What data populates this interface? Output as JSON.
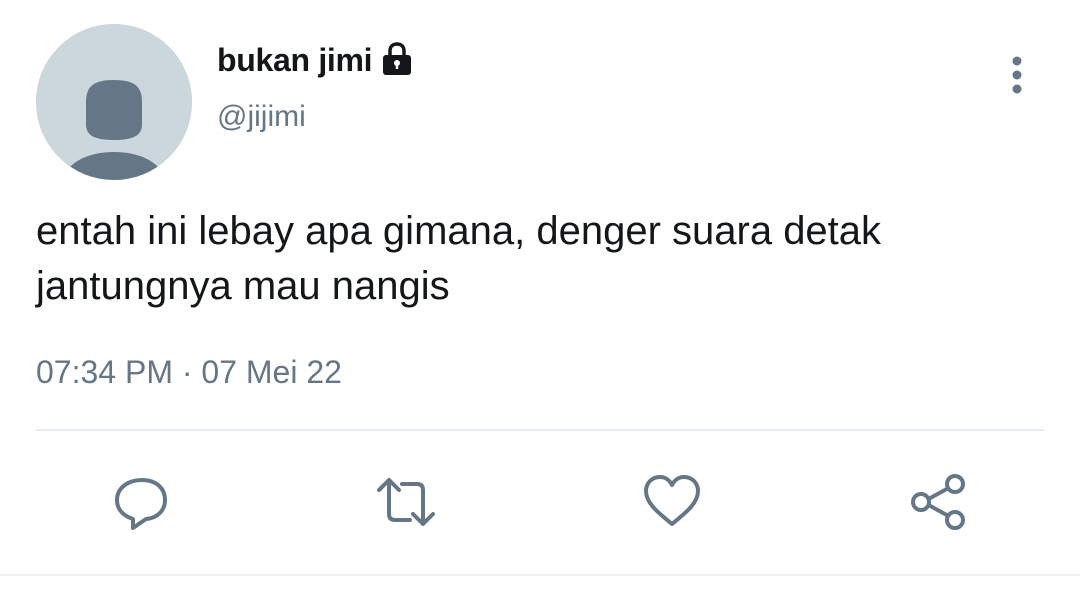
{
  "user": {
    "display_name": "bukan jimi",
    "handle": "@jijimi",
    "protected_icon": "lock-icon",
    "avatar": "default-avatar"
  },
  "tweet": {
    "text_line1": "entah ini lebay apa gimana, denger suara detak",
    "text_line2": "jantungnya mau nangis",
    "timestamp": "07:34 PM · 07 Mei 22"
  },
  "actions": [
    {
      "name": "reply",
      "icon": "reply-icon"
    },
    {
      "name": "retweet",
      "icon": "retweet-icon"
    },
    {
      "name": "like",
      "icon": "heart-icon"
    },
    {
      "name": "share",
      "icon": "share-icon"
    }
  ],
  "colors": {
    "text_primary": "#14171a",
    "text_secondary": "#657786",
    "avatar_bg": "#ccd6dd",
    "avatar_figure": "#657786",
    "divider": "#e6ecf0"
  }
}
